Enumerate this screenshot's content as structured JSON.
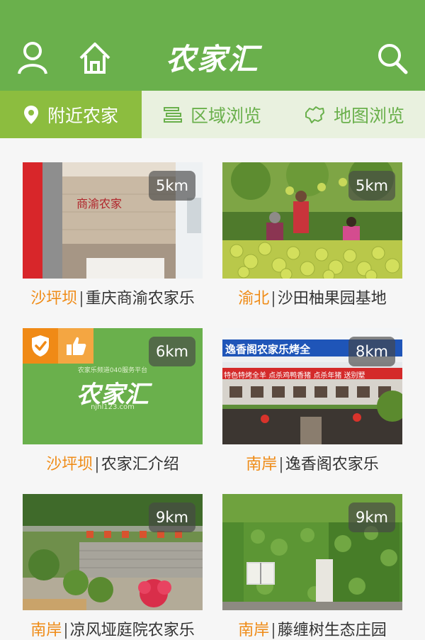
{
  "header": {
    "logo_text": "农家汇",
    "color": "#6ab04c"
  },
  "tabs": [
    {
      "label": "附近农家",
      "icon": "location-pin-icon",
      "active": true
    },
    {
      "label": "区域浏览",
      "icon": "list-icon",
      "active": false
    },
    {
      "label": "地图浏览",
      "icon": "map-icon",
      "active": false
    }
  ],
  "cards": [
    {
      "area": "沙坪坝",
      "name": "重庆商渝农家乐",
      "distance": "5km"
    },
    {
      "area": "渝北",
      "name": "沙田柚果园基地",
      "distance": "5km"
    },
    {
      "area": "沙坪坝",
      "name": "农家汇介绍",
      "distance": "6km",
      "logo_text": "农家汇",
      "logo_subtext": "农家乐频道040服务平台",
      "logo_url_text": "njhl123.com"
    },
    {
      "area": "南岸",
      "name": "逸香阁农家乐",
      "distance": "8km",
      "sign_text": "逸香阁农家乐烤全",
      "banner_text": "特色特烤全羊 点杀鸡鸭香猪 点杀年猪 送别墅"
    },
    {
      "area": "南岸",
      "name": "凉风垭庭院农家乐",
      "distance": "9km"
    },
    {
      "area": "南岸",
      "name": "藤缠树生态庄园",
      "distance": "9km"
    }
  ],
  "colors": {
    "accent": "#6ab04c",
    "tab_active": "#8cbd3f",
    "area_text": "#ef8b16"
  }
}
